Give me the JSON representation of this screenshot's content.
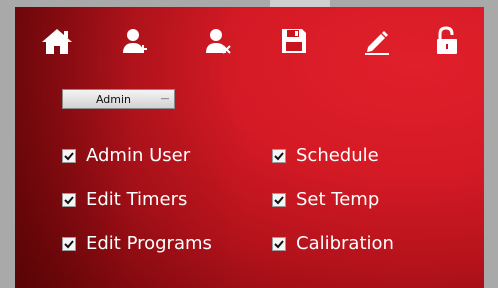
{
  "toolbar": {
    "icons": [
      "home-icon",
      "add-user-icon",
      "remove-user-icon",
      "save-icon",
      "edit-icon",
      "unlock-icon"
    ]
  },
  "role_selector": {
    "value": "Admin"
  },
  "permissions": {
    "left": [
      {
        "label": "Admin User",
        "checked": true
      },
      {
        "label": "Edit Timers",
        "checked": true
      },
      {
        "label": "Edit Programs",
        "checked": true
      }
    ],
    "right": [
      {
        "label": "Schedule",
        "checked": true
      },
      {
        "label": "Set Temp",
        "checked": true
      },
      {
        "label": "Calibration",
        "checked": true
      }
    ]
  },
  "colors": {
    "panel_red": "#d41a25",
    "panel_dark": "#7a080c",
    "outer_gray": "#a9a9a9",
    "text": "#ffffff"
  }
}
